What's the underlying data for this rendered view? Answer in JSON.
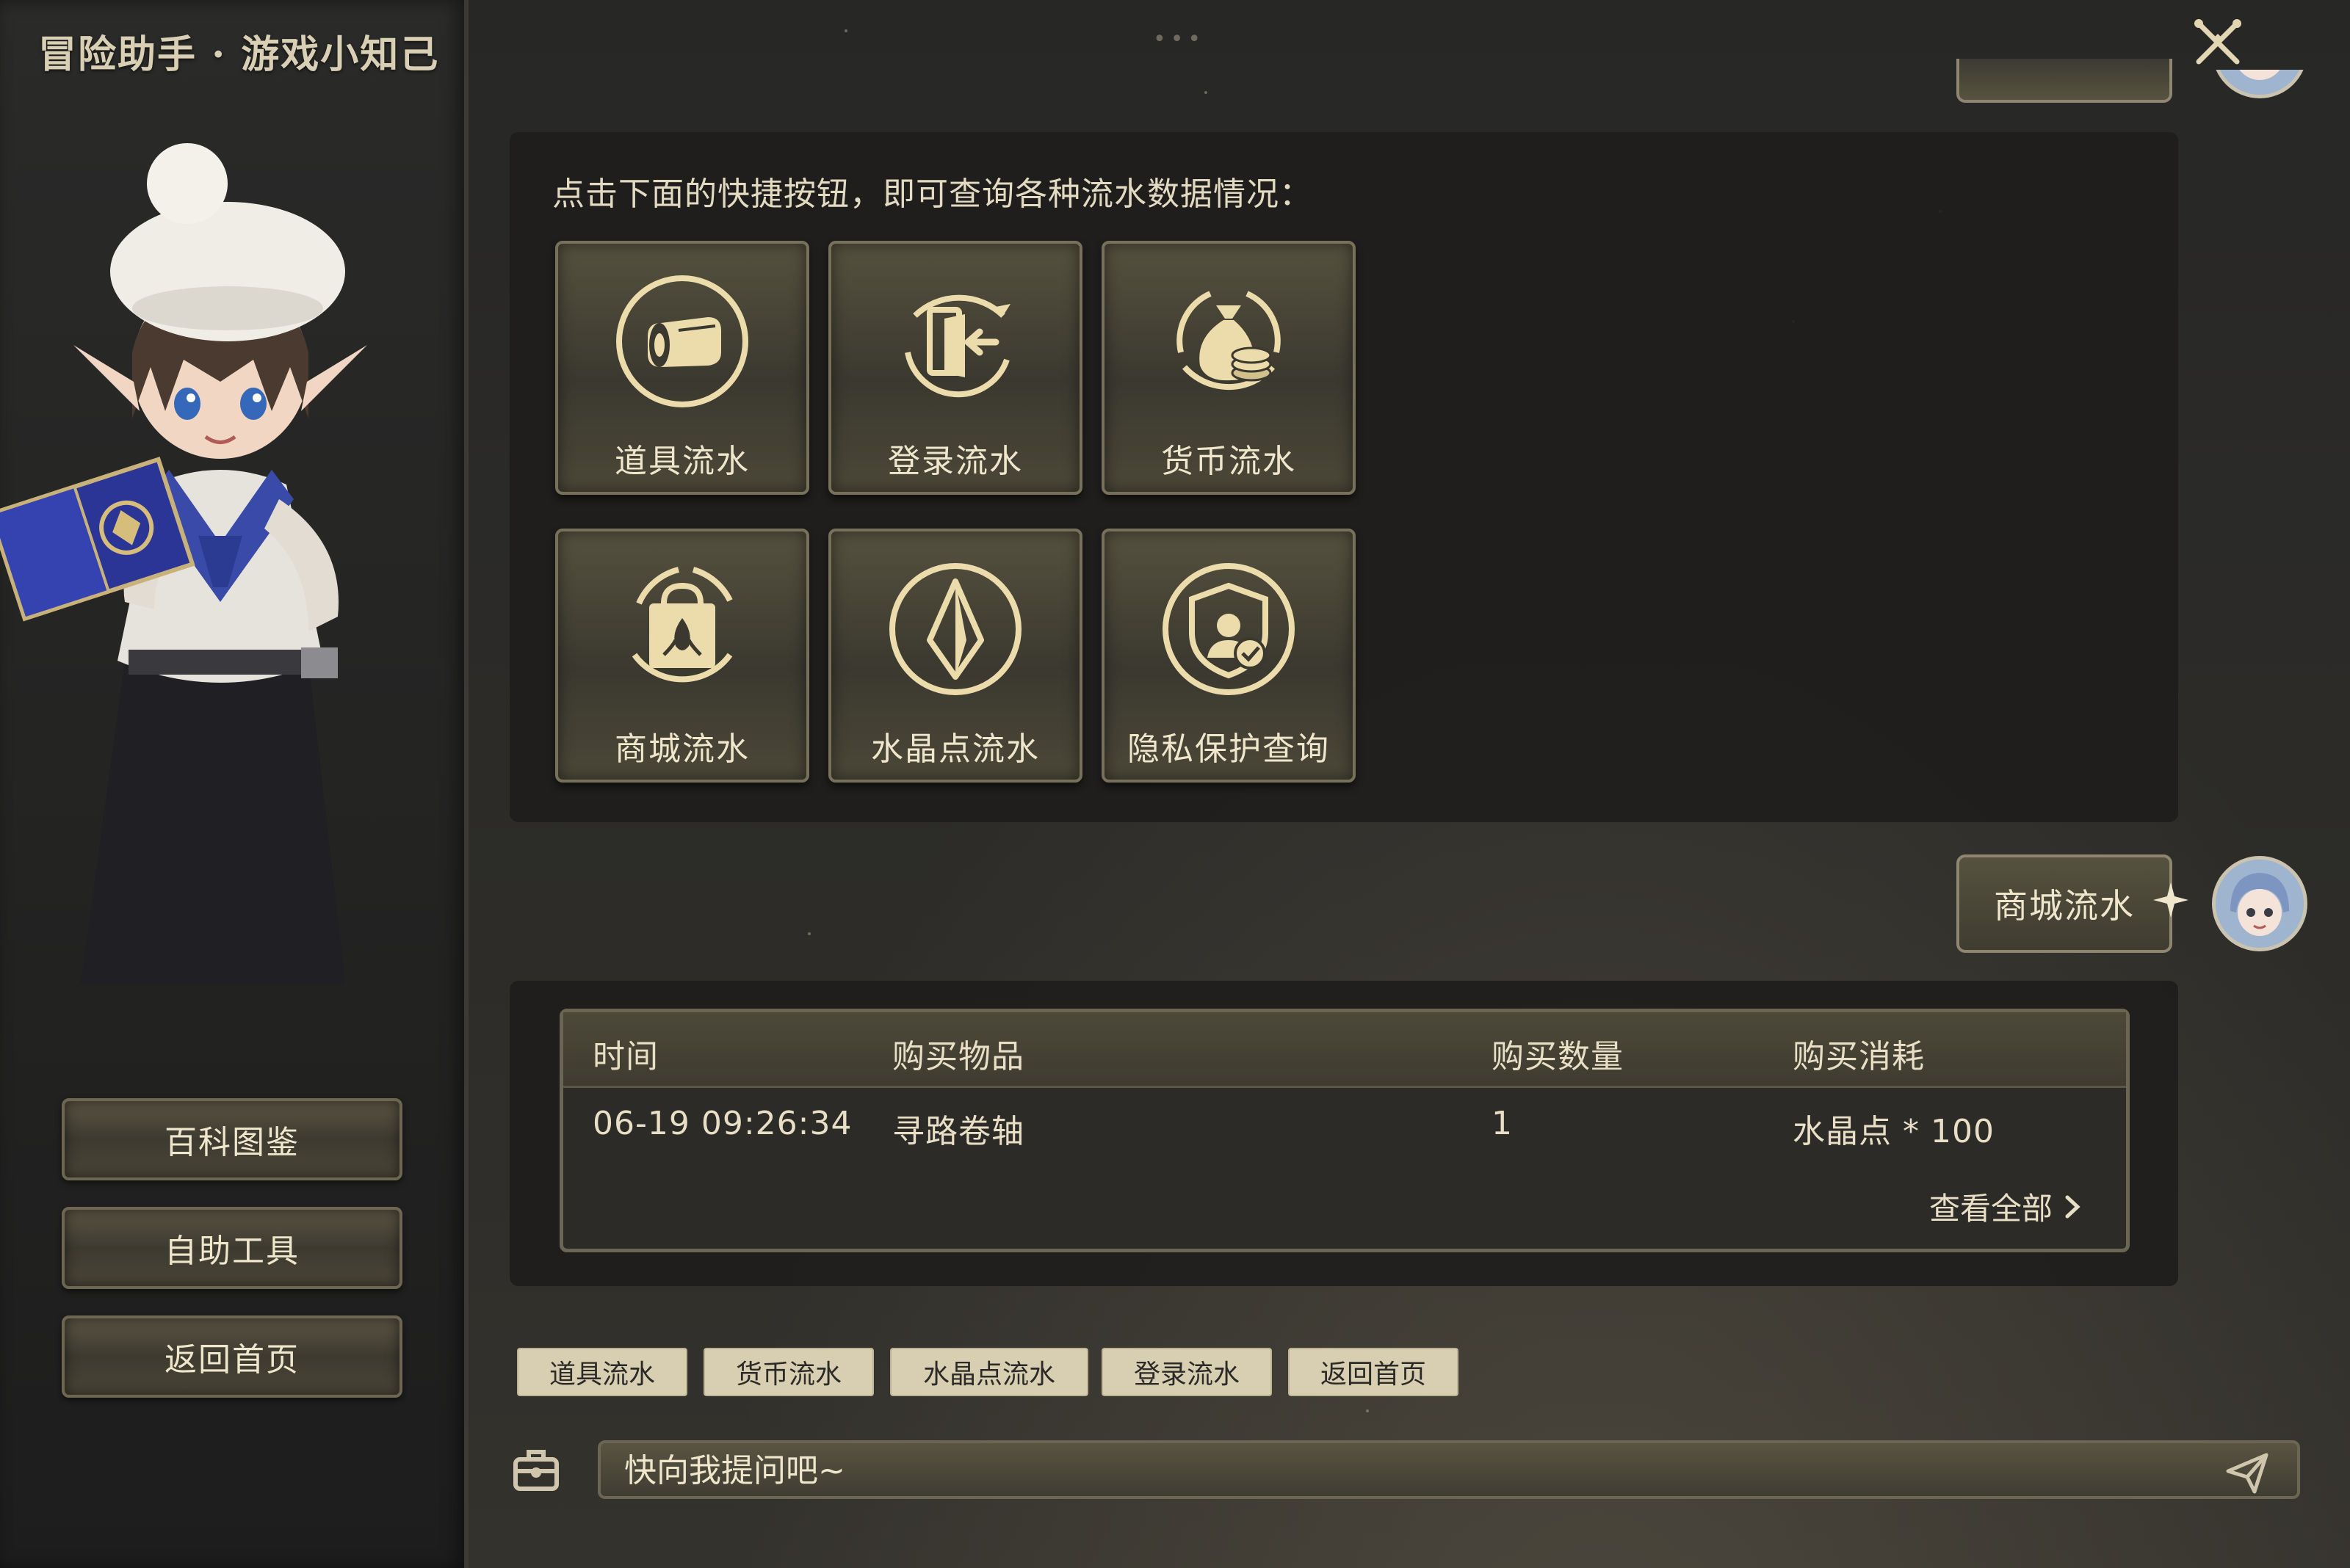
{
  "app": {
    "title": "冒险助手 · 游戏小知己"
  },
  "sidebar": {
    "buttons": [
      {
        "label": "百科图鉴"
      },
      {
        "label": "自助工具"
      },
      {
        "label": "返回首页"
      }
    ]
  },
  "header": {
    "more_dots": "•••"
  },
  "quick_panel": {
    "intro": "点击下面的快捷按钮，即可查询各种流水数据情况：",
    "tiles": [
      {
        "label": "道具流水",
        "icon": "scroll-icon"
      },
      {
        "label": "登录流水",
        "icon": "login-icon"
      },
      {
        "label": "货币流水",
        "icon": "money-bag-icon"
      },
      {
        "label": "商城流水",
        "icon": "shopping-bag-icon"
      },
      {
        "label": "水晶点流水",
        "icon": "crystal-icon"
      },
      {
        "label": "隐私保护查询",
        "icon": "privacy-shield-icon"
      }
    ]
  },
  "user_message": {
    "text": "商城流水"
  },
  "result": {
    "columns": [
      "时间",
      "购买物品",
      "购买数量",
      "购买消耗"
    ],
    "rows": [
      [
        "06-19 09:26:34",
        "寻路卷轴",
        "1",
        "水晶点 * 100"
      ]
    ],
    "view_all": "查看全部"
  },
  "quick_chips": [
    "道具流水",
    "货币流水",
    "水晶点流水",
    "登录流水",
    "返回首页"
  ],
  "input": {
    "placeholder": "快向我提问吧~"
  },
  "colors": {
    "gold": "#e7d7a6",
    "panel": "#1e1d1b",
    "chip": "#d8cfb2"
  }
}
